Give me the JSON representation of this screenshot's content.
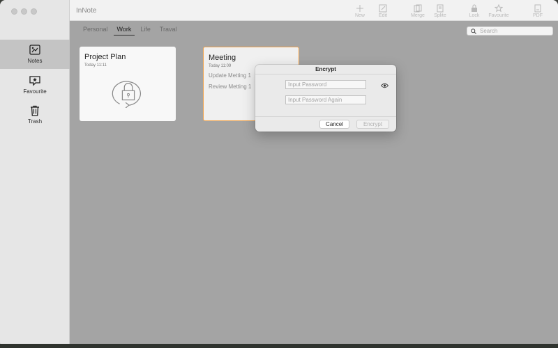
{
  "app": {
    "title": "InNote"
  },
  "toolbar": {
    "items": [
      {
        "label": "New",
        "icon": "plus-icon"
      },
      {
        "label": "Edit",
        "icon": "edit-icon"
      },
      {
        "label": "Merge",
        "icon": "merge-icon"
      },
      {
        "label": "Splite",
        "icon": "split-icon"
      },
      {
        "label": "Lock",
        "icon": "lock-icon"
      },
      {
        "label": "Favourite",
        "icon": "star-icon"
      },
      {
        "label": "PDF",
        "icon": "pdf-icon"
      }
    ]
  },
  "sidebar": {
    "items": [
      {
        "label": "Notes",
        "icon": "notes-icon",
        "active": true
      },
      {
        "label": "Favourite",
        "icon": "favourite-icon",
        "active": false
      },
      {
        "label": "Trash",
        "icon": "trash-icon",
        "active": false
      }
    ]
  },
  "tabs": [
    {
      "label": "Personal",
      "active": false
    },
    {
      "label": "Work",
      "active": true
    },
    {
      "label": "Life",
      "active": false
    },
    {
      "label": "Traval",
      "active": false
    }
  ],
  "search": {
    "placeholder": "Search",
    "value": ""
  },
  "notes": [
    {
      "title": "Project Plan",
      "date": "Today 11:11",
      "locked": true,
      "selected": false,
      "lines": []
    },
    {
      "title": "Meeting",
      "date": "Today 11:09",
      "locked": false,
      "selected": true,
      "lines": [
        "Update Metting 1",
        "Review Metting 1"
      ]
    }
  ],
  "dialog": {
    "title": "Encrypt",
    "password_placeholder": "Input Password",
    "password_value": "",
    "confirm_placeholder": "Input Password Again",
    "confirm_value": "",
    "cancel_label": "Cancel",
    "encrypt_label": "Encrypt",
    "encrypt_enabled": false
  },
  "colors": {
    "overlay": "#a4a4a4",
    "sidebar": "#e6e6e6",
    "sidebar_active": "#c4c4c4",
    "selected_card_border": "#f0a24a"
  }
}
